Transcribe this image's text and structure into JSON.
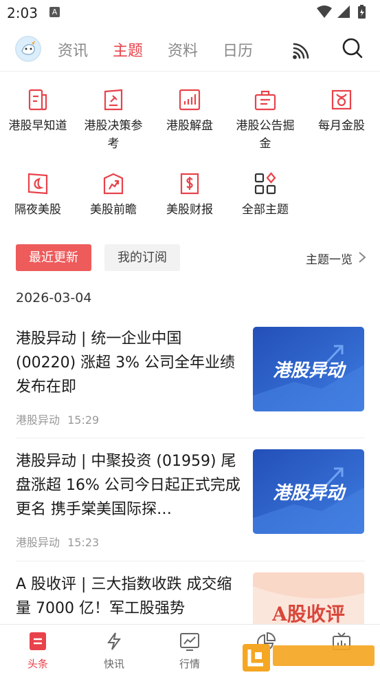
{
  "status": {
    "time": "2:03",
    "notif_letter": "A"
  },
  "nav": {
    "tabs": [
      "资讯",
      "主题",
      "资料",
      "日历"
    ],
    "active_tab": "主题"
  },
  "topics": [
    {
      "label": "港股早知道",
      "icon": "document-icon"
    },
    {
      "label": "港股决策参考",
      "icon": "gavel-icon"
    },
    {
      "label": "港股解盘",
      "icon": "bar-chart-icon"
    },
    {
      "label": "港股公告掘金",
      "icon": "briefcase-icon"
    },
    {
      "label": "每月金股",
      "icon": "taurus-icon"
    },
    {
      "label": "隔夜美股",
      "icon": "moon-icon"
    },
    {
      "label": "美股前瞻",
      "icon": "trend-arrow-icon"
    },
    {
      "label": "美股财报",
      "icon": "dollar-doc-icon"
    },
    {
      "label": "全部主题",
      "icon": "grid-icon"
    }
  ],
  "filter": {
    "latest": "最近更新",
    "subscriptions": "我的订阅",
    "overview": "主题一览"
  },
  "date": "2026-03-04",
  "articles": [
    {
      "title": "港股异动 | 统一企业中国 (00220) 涨超 3% 公司全年业绩发布在即",
      "source": "港股异动",
      "time": "15:29",
      "thumb_text": "港股异动"
    },
    {
      "title": "港股异动 | 中聚投资 (01959) 尾盘涨超 16% 公司今日起正式完成更名 携手棠美国际探…",
      "source": "港股异动",
      "time": "15:23",
      "thumb_text": "港股异动"
    },
    {
      "title": "A 股收评 | 三大指数收跌 成交缩量 7000 亿！军工股强势",
      "source": "",
      "time": "",
      "thumb_text": "A股收评"
    }
  ],
  "bottom_nav": [
    {
      "label": "头条",
      "icon": "headline-icon",
      "active": true
    },
    {
      "label": "快讯",
      "icon": "lightning-icon",
      "active": false
    },
    {
      "label": "行情",
      "icon": "market-chart-icon",
      "active": false
    },
    {
      "label": "",
      "icon": "pie-chart-icon",
      "active": false
    },
    {
      "label": "",
      "icon": "tv-icon",
      "active": false
    }
  ],
  "colors": {
    "accent": "#e8424a",
    "pill_red": "#ee5b5b",
    "thumb_blue": "#2a5bc4"
  }
}
